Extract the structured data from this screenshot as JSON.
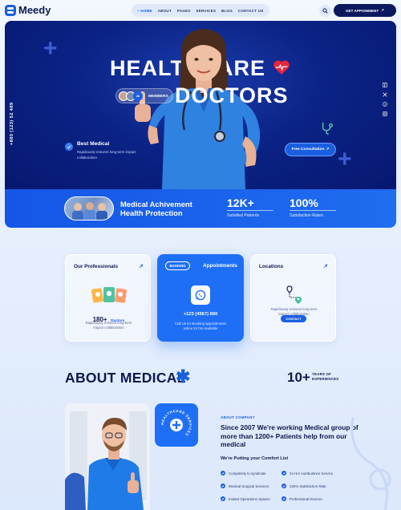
{
  "header": {
    "logo_text": "Meedy",
    "nav": [
      "HOME",
      "ABOUT",
      "PAGES",
      "SERVICES",
      "BLOG",
      "CONTACT US"
    ],
    "cta_label": "GET APPOINMENT"
  },
  "hero": {
    "title_line1": "HEALTHCARE",
    "title_line2": "DOCTORS",
    "members_count": "2k",
    "members_label": "MEMBERS",
    "phone": "+880 (123) 52 489",
    "best_title": "Best Medical",
    "best_text": "Rapidiously reinvent long-term impact collaboration",
    "cta_label": "Free Consultation",
    "social_icons": [
      "facebook-icon",
      "x-icon",
      "pinterest-icon",
      "instagram-icon"
    ]
  },
  "achievement": {
    "title_line1": "Medical Achivement",
    "title_line2": "Health Protection",
    "stats": [
      {
        "value": "12K+",
        "label": "Satisfied Patients"
      },
      {
        "value": "100%",
        "label": "Satisfaction Rates"
      }
    ]
  },
  "cards": {
    "professionals": {
      "title": "Our Professionals",
      "count": "180+",
      "count_label": "Doctors",
      "text": "Rapidiously reinvent long-term impact collaboration"
    },
    "booking": {
      "pill": "BOOKING",
      "title": "Appointments",
      "phone": "+123 (4567) 890",
      "text": "Call Us for Booking appointments online 24 hrs available"
    },
    "locations": {
      "title": "Locations",
      "text": "Rapidiously reinvent long-term impact collaboration",
      "button": "CONTACT"
    }
  },
  "about": {
    "title": "ABOUT MEDICAL",
    "years_value": "10+",
    "years_label_1": "YEARS OF",
    "years_label_2": "EXPERIENCES",
    "badge_text": "HEALTHCARE SERVICES",
    "kicker": "ABOUT COMPANY",
    "heading": "Since 2007 We're working Medical group of more than 1200+ Patients help from our medical",
    "subheading": "We're Putting your Comfort List",
    "features": [
      "Completely to syndicate",
      "24 Hrs Aumbulance Service",
      "Medical Surgical Services",
      "100% Satisfaction Rate",
      "Instant Operations System",
      "Professional Doctors"
    ]
  },
  "colors": {
    "primary": "#1a5fe0",
    "navy": "#0b1a5e",
    "hero": "#0b2386",
    "heart": "#e8243c"
  }
}
